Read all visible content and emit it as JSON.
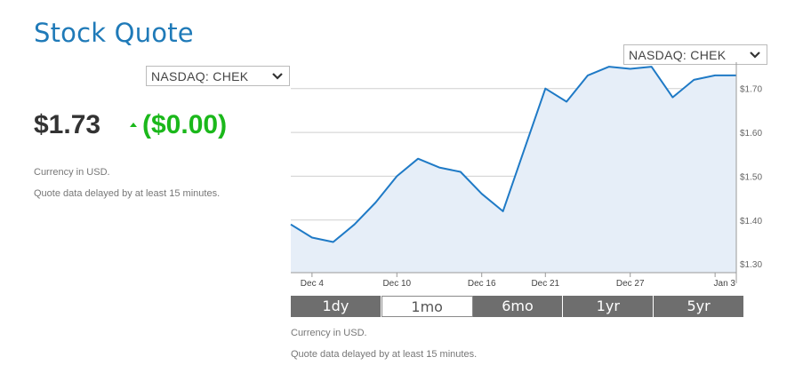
{
  "page": {
    "title": "Stock Quote"
  },
  "selector_left": {
    "value": "NASDAQ: CHEK"
  },
  "selector_right": {
    "value": "NASDAQ: CHEK"
  },
  "quote": {
    "price": "$1.73",
    "change": "($0.00)",
    "direction": "up",
    "change_color": "#1bb81b",
    "currency_note": "Currency in USD.",
    "delay_note": "Quote data delayed by at least 15 minutes."
  },
  "chart_footer": {
    "currency_note": "Currency in USD.",
    "delay_note": "Quote data delayed by at least 15 minutes."
  },
  "range_buttons": [
    {
      "label": "1dy",
      "active": false
    },
    {
      "label": "1mo",
      "active": true
    },
    {
      "label": "6mo",
      "active": false
    },
    {
      "label": "1yr",
      "active": false
    },
    {
      "label": "5yr",
      "active": false
    }
  ],
  "chart_data": {
    "type": "area",
    "title": "",
    "xlabel": "",
    "ylabel": "",
    "ylim": [
      1.28,
      1.74
    ],
    "yticks": [
      1.3,
      1.4,
      1.5,
      1.6,
      1.7
    ],
    "ytick_labels": [
      "$1.30",
      "$1.40",
      "$1.50",
      "$1.60",
      "$1.70"
    ],
    "xticks": [
      "Dec 4",
      "Dec 10",
      "Dec 16",
      "Dec 21",
      "Dec 27",
      "Jan 3"
    ],
    "xtick_index": [
      1,
      5,
      9,
      12,
      16,
      20
    ],
    "x_count": 21,
    "values": [
      1.39,
      1.36,
      1.35,
      1.39,
      1.44,
      1.5,
      1.54,
      1.52,
      1.51,
      1.46,
      1.42,
      1.56,
      1.7,
      1.67,
      1.73,
      1.75,
      1.745,
      1.75,
      1.68,
      1.72,
      1.73,
      1.73
    ],
    "grid": true,
    "colors": {
      "line": "#1f7ac6",
      "fill": "#e6eef8",
      "grid": "#cfcfcf",
      "axis_text": "#666"
    }
  }
}
